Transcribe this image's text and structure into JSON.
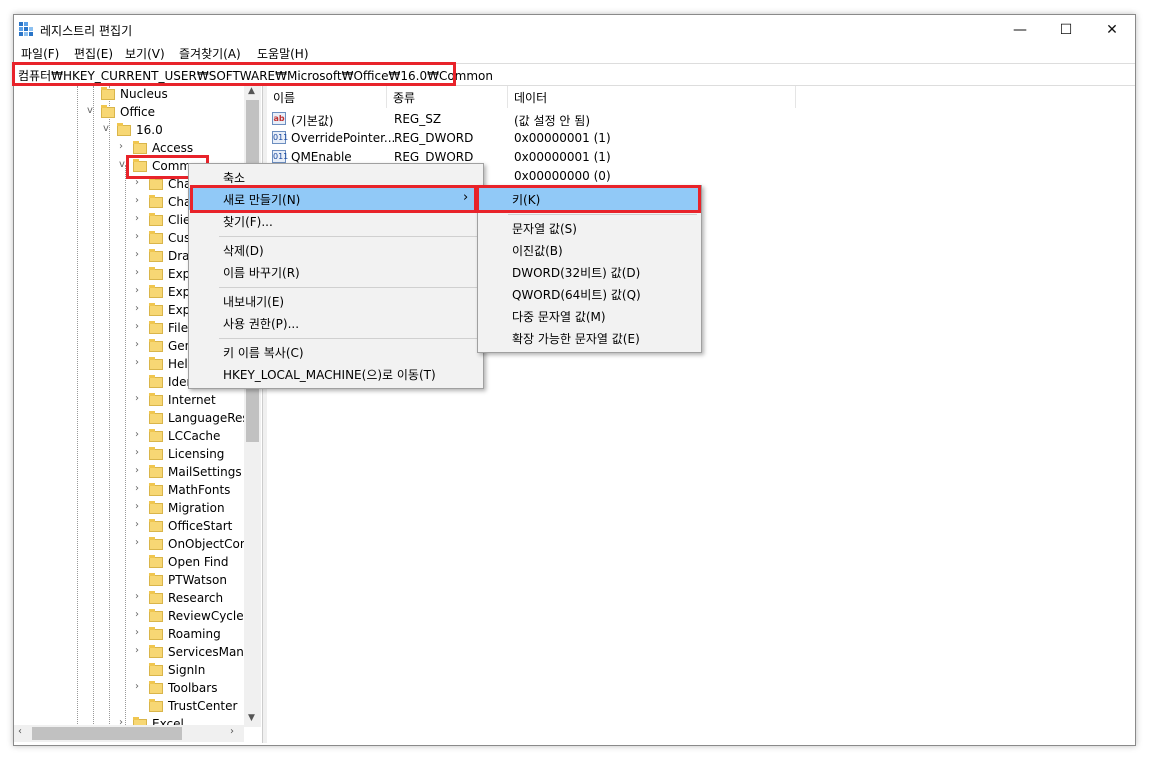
{
  "window": {
    "title": "레지스트리 편집기",
    "minimize": "—",
    "maximize": "☐",
    "close": "✕"
  },
  "menubar": [
    "파일(F)",
    "편집(E)",
    "보기(V)",
    "즐겨찾기(A)",
    "도움말(H)"
  ],
  "address": "컴퓨터₩HKEY_CURRENT_USER₩SOFTWARE₩Microsoft₩Office₩16.0₩Common",
  "tree": {
    "nucleus": "Nucleus",
    "office": "Office",
    "v160": "16.0",
    "access": "Access",
    "common": "Comm",
    "children": [
      "Cha",
      "Cha",
      "Clie",
      "Cus",
      "Dra",
      "Exp",
      "Exp",
      "Exp",
      "FileI",
      "Gen",
      "Help",
      "Iden",
      "Internet",
      "LanguageReso",
      "LCCache",
      "Licensing",
      "MailSettings",
      "MathFonts",
      "Migration",
      "OfficeStart",
      "OnObjectCon",
      "Open Find",
      "PTWatson",
      "Research",
      "ReviewCycle",
      "Roaming",
      "ServicesMana",
      "SignIn",
      "Toolbars",
      "TrustCenter"
    ],
    "excel": "Excel"
  },
  "columns": {
    "name": "이름",
    "type": "종류",
    "data": "데이터"
  },
  "values": [
    {
      "icon": "ab",
      "name": "(기본값)",
      "type": "REG_SZ",
      "data": "(값 설정 안 됨)"
    },
    {
      "icon": "bin",
      "name": "OverridePointer...",
      "type": "REG_DWORD",
      "data": "0x00000001 (1)"
    },
    {
      "icon": "bin",
      "name": "QMEnable",
      "type": "REG_DWORD",
      "data": "0x00000001 (1)"
    },
    {
      "icon": "bin",
      "name": "",
      "type": "",
      "data": "0x00000000 (0)"
    }
  ],
  "context_menu": {
    "collapse": "축소",
    "new": "새로 만들기(N)",
    "find": "찾기(F)...",
    "delete": "삭제(D)",
    "rename": "이름 바꾸기(R)",
    "export": "내보내기(E)",
    "permissions": "사용 권한(P)...",
    "copy_key": "키 이름 복사(C)",
    "goto_hklm": "HKEY_LOCAL_MACHINE(으)로 이동(T)",
    "arrow": "›"
  },
  "submenu": {
    "key": "키(K)",
    "string": "문자열 값(S)",
    "binary": "이진값(B)",
    "dword": "DWORD(32비트) 값(D)",
    "qword": "QWORD(64비트) 값(Q)",
    "multi": "다중 문자열 값(M)",
    "expand": "확장 가능한 문자열 값(E)"
  },
  "colors": {
    "highlight": "#e8232a",
    "selection": "#91c9f7"
  }
}
